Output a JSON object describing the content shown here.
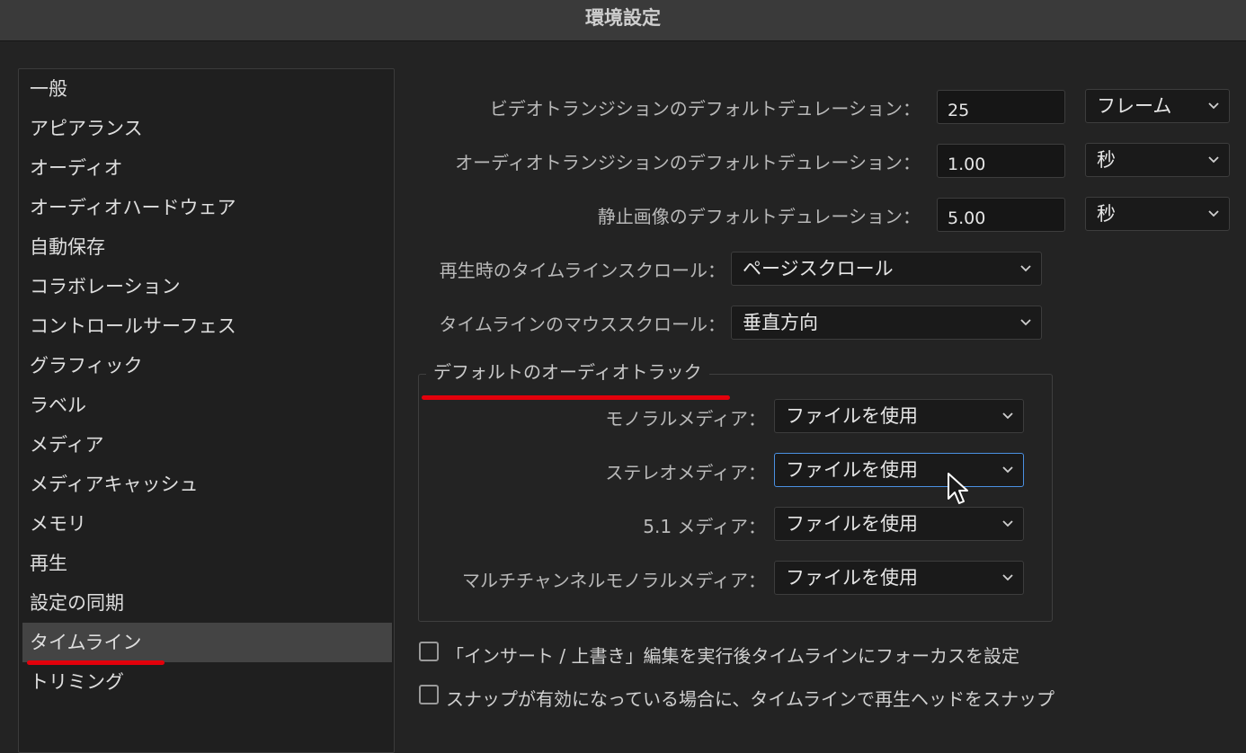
{
  "window": {
    "title": "環境設定"
  },
  "sidebar": {
    "items": [
      {
        "label": "一般"
      },
      {
        "label": "アピアランス"
      },
      {
        "label": "オーディオ"
      },
      {
        "label": "オーディオハードウェア"
      },
      {
        "label": "自動保存"
      },
      {
        "label": "コラボレーション"
      },
      {
        "label": "コントロールサーフェス"
      },
      {
        "label": "グラフィック"
      },
      {
        "label": "ラベル"
      },
      {
        "label": "メディア"
      },
      {
        "label": "メディアキャッシュ"
      },
      {
        "label": "メモリ"
      },
      {
        "label": "再生"
      },
      {
        "label": "設定の同期"
      },
      {
        "label": "タイムライン",
        "selected": true
      },
      {
        "label": "トリミング"
      }
    ]
  },
  "timeline_settings": {
    "video_transition": {
      "label": "ビデオトランジションのデフォルトデュレーション：",
      "value": "25",
      "unit": "フレーム"
    },
    "audio_transition": {
      "label": "オーディオトランジションのデフォルトデュレーション：",
      "value": "1.00",
      "unit": "秒"
    },
    "still_image": {
      "label": "静止画像のデフォルトデュレーション：",
      "value": "5.00",
      "unit": "秒"
    },
    "playback_scroll": {
      "label": "再生時のタイムラインスクロール：",
      "value": "ページスクロール"
    },
    "mouse_scroll": {
      "label": "タイムラインのマウススクロール：",
      "value": "垂直方向"
    },
    "default_audio_tracks": {
      "title": "デフォルトのオーディオトラック",
      "mono": {
        "label": "モノラルメディア：",
        "value": "ファイルを使用"
      },
      "stereo": {
        "label": "ステレオメディア：",
        "value": "ファイルを使用"
      },
      "surround": {
        "label": "5.1 メディア：",
        "value": "ファイルを使用"
      },
      "multichannel": {
        "label": "マルチチャンネルモノラルメディア：",
        "value": "ファイルを使用"
      }
    },
    "checkboxes": [
      {
        "label": "「インサート / 上書き」編集を実行後タイムラインにフォーカスを設定",
        "checked": false
      },
      {
        "label": "スナップが有効になっている場合に、タイムラインで再生ヘッドをスナップ",
        "checked": false
      }
    ]
  },
  "colors": {
    "accent_focus": "#4a90e2",
    "annotation_red": "#e3000b"
  },
  "icons": {
    "dropdown": "chevron-down-icon",
    "cursor": "mouse-pointer-icon"
  }
}
